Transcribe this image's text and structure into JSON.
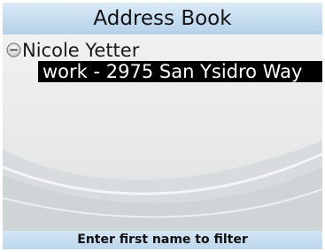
{
  "app": {
    "title": "Address Book"
  },
  "contacts": [
    {
      "name": "Nicole Yetter",
      "expanded": true,
      "addresses": [
        {
          "label": "work - 2975 San Ysidro Way",
          "selected": true
        }
      ]
    }
  ],
  "status": {
    "hint": "Enter first name to filter"
  },
  "colors": {
    "title_bar": "#c4dcef",
    "selection": "#000000",
    "selection_text": "#ffffff",
    "content_bg": "#ececec"
  },
  "icons": {
    "contact_toggle": "collapse-minus-icon"
  }
}
